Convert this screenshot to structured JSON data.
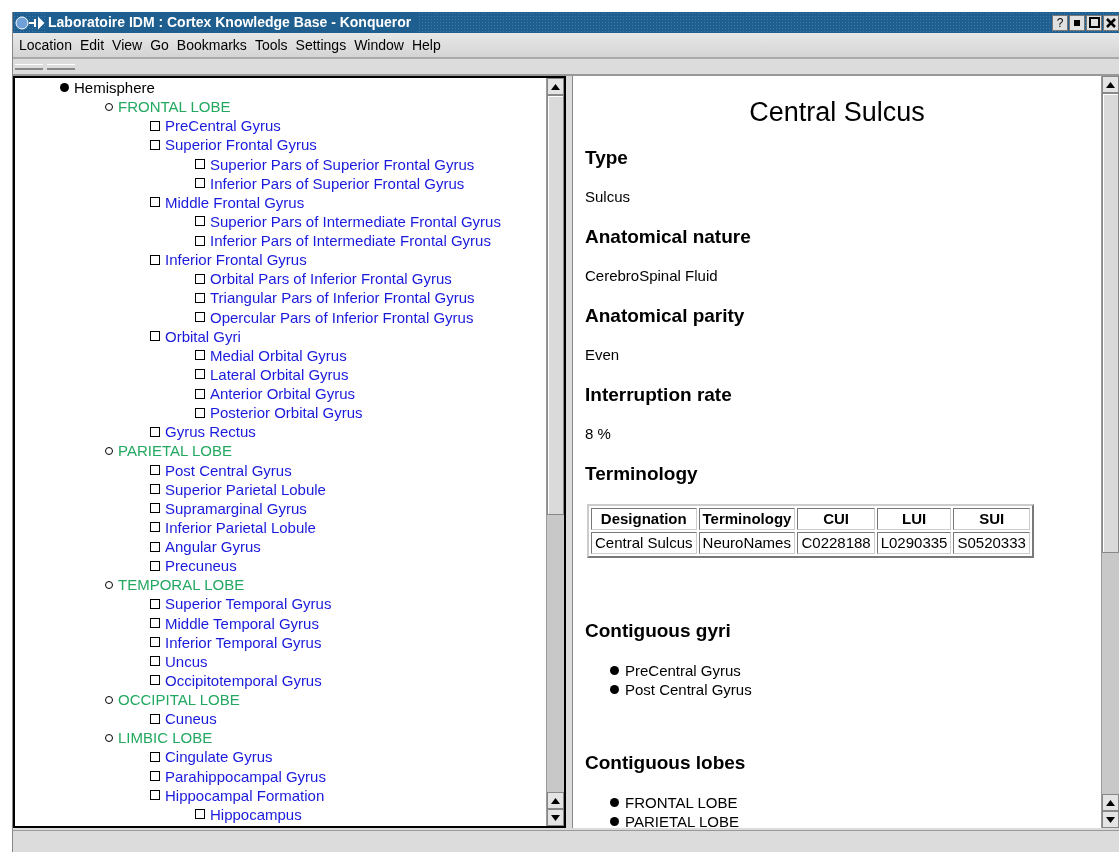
{
  "window": {
    "title": "Laboratoire IDM : Cortex Knowledge Base - Konqueror",
    "help_button": "?"
  },
  "menu": [
    "Location",
    "Edit",
    "View",
    "Go",
    "Bookmarks",
    "Tools",
    "Settings",
    "Window",
    "Help"
  ],
  "tree": [
    {
      "label": "Hemisphere",
      "kind": "root",
      "children": [
        {
          "label": "FRONTAL LOBE",
          "kind": "lobe",
          "children": [
            {
              "label": "PreCentral Gyrus",
              "kind": "gyrus"
            },
            {
              "label": "Superior Frontal Gyrus",
              "kind": "gyrus",
              "children": [
                {
                  "label": "Superior Pars of Superior Frontal Gyrus",
                  "kind": "gyrus"
                },
                {
                  "label": "Inferior Pars of Superior Frontal Gyrus",
                  "kind": "gyrus"
                }
              ]
            },
            {
              "label": "Middle Frontal Gyrus",
              "kind": "gyrus",
              "children": [
                {
                  "label": "Superior Pars of Intermediate Frontal Gyrus",
                  "kind": "gyrus"
                },
                {
                  "label": "Inferior Pars of Intermediate Frontal Gyrus",
                  "kind": "gyrus"
                }
              ]
            },
            {
              "label": "Inferior Frontal Gyrus",
              "kind": "gyrus",
              "children": [
                {
                  "label": "Orbital Pars of Inferior Frontal Gyrus",
                  "kind": "gyrus"
                },
                {
                  "label": "Triangular Pars of Inferior Frontal Gyrus",
                  "kind": "gyrus"
                },
                {
                  "label": "Opercular Pars of Inferior Frontal Gyrus",
                  "kind": "gyrus"
                }
              ]
            },
            {
              "label": "Orbital Gyri",
              "kind": "gyrus",
              "children": [
                {
                  "label": "Medial Orbital Gyrus",
                  "kind": "gyrus"
                },
                {
                  "label": "Lateral Orbital Gyrus",
                  "kind": "gyrus"
                },
                {
                  "label": "Anterior Orbital Gyrus",
                  "kind": "gyrus"
                },
                {
                  "label": "Posterior Orbital Gyrus",
                  "kind": "gyrus"
                }
              ]
            },
            {
              "label": "Gyrus Rectus",
              "kind": "gyrus"
            }
          ]
        },
        {
          "label": "PARIETAL LOBE",
          "kind": "lobe",
          "children": [
            {
              "label": "Post Central Gyrus",
              "kind": "gyrus"
            },
            {
              "label": "Superior Parietal Lobule",
              "kind": "gyrus"
            },
            {
              "label": "Supramarginal Gyrus",
              "kind": "gyrus"
            },
            {
              "label": "Inferior Parietal Lobule",
              "kind": "gyrus"
            },
            {
              "label": "Angular Gyrus",
              "kind": "gyrus"
            },
            {
              "label": "Precuneus",
              "kind": "gyrus"
            }
          ]
        },
        {
          "label": "TEMPORAL LOBE",
          "kind": "lobe",
          "children": [
            {
              "label": "Superior Temporal Gyrus",
              "kind": "gyrus"
            },
            {
              "label": "Middle Temporal Gyrus",
              "kind": "gyrus"
            },
            {
              "label": "Inferior Temporal Gyrus",
              "kind": "gyrus"
            },
            {
              "label": "Uncus",
              "kind": "gyrus"
            },
            {
              "label": "Occipitotemporal Gyrus",
              "kind": "gyrus"
            }
          ]
        },
        {
          "label": "OCCIPITAL LOBE",
          "kind": "lobe",
          "children": [
            {
              "label": "Cuneus",
              "kind": "gyrus"
            }
          ]
        },
        {
          "label": "LIMBIC LOBE",
          "kind": "lobe",
          "children": [
            {
              "label": "Cingulate Gyrus",
              "kind": "gyrus"
            },
            {
              "label": "Parahippocampal Gyrus",
              "kind": "gyrus"
            },
            {
              "label": "Hippocampal Formation",
              "kind": "gyrus",
              "children": [
                {
                  "label": "Hippocampus",
                  "kind": "gyrus"
                }
              ]
            }
          ]
        }
      ]
    }
  ],
  "article": {
    "title": "Central Sulcus",
    "sections": [
      {
        "heading": "Type",
        "kind": "text",
        "text": "Sulcus"
      },
      {
        "heading": "Anatomical nature",
        "kind": "text",
        "text": "CerebroSpinal Fluid"
      },
      {
        "heading": "Anatomical parity",
        "kind": "text",
        "text": "Even"
      },
      {
        "heading": "Interruption rate",
        "kind": "text",
        "text": "8 %"
      },
      {
        "heading": "Terminology",
        "kind": "table",
        "columns": [
          "Designation",
          "Terminology",
          "CUI",
          "LUI",
          "SUI"
        ],
        "rows": [
          [
            "Central Sulcus",
            "NeuroNames",
            "C0228188",
            "L0290335",
            "S0520333"
          ]
        ]
      },
      {
        "heading": "Contiguous gyri",
        "kind": "links",
        "items": [
          "PreCentral Gyrus",
          "Post Central Gyrus"
        ]
      },
      {
        "heading": "Contiguous lobes",
        "kind": "links",
        "items": [
          "FRONTAL LOBE",
          "PARIETAL LOBE"
        ]
      }
    ]
  }
}
